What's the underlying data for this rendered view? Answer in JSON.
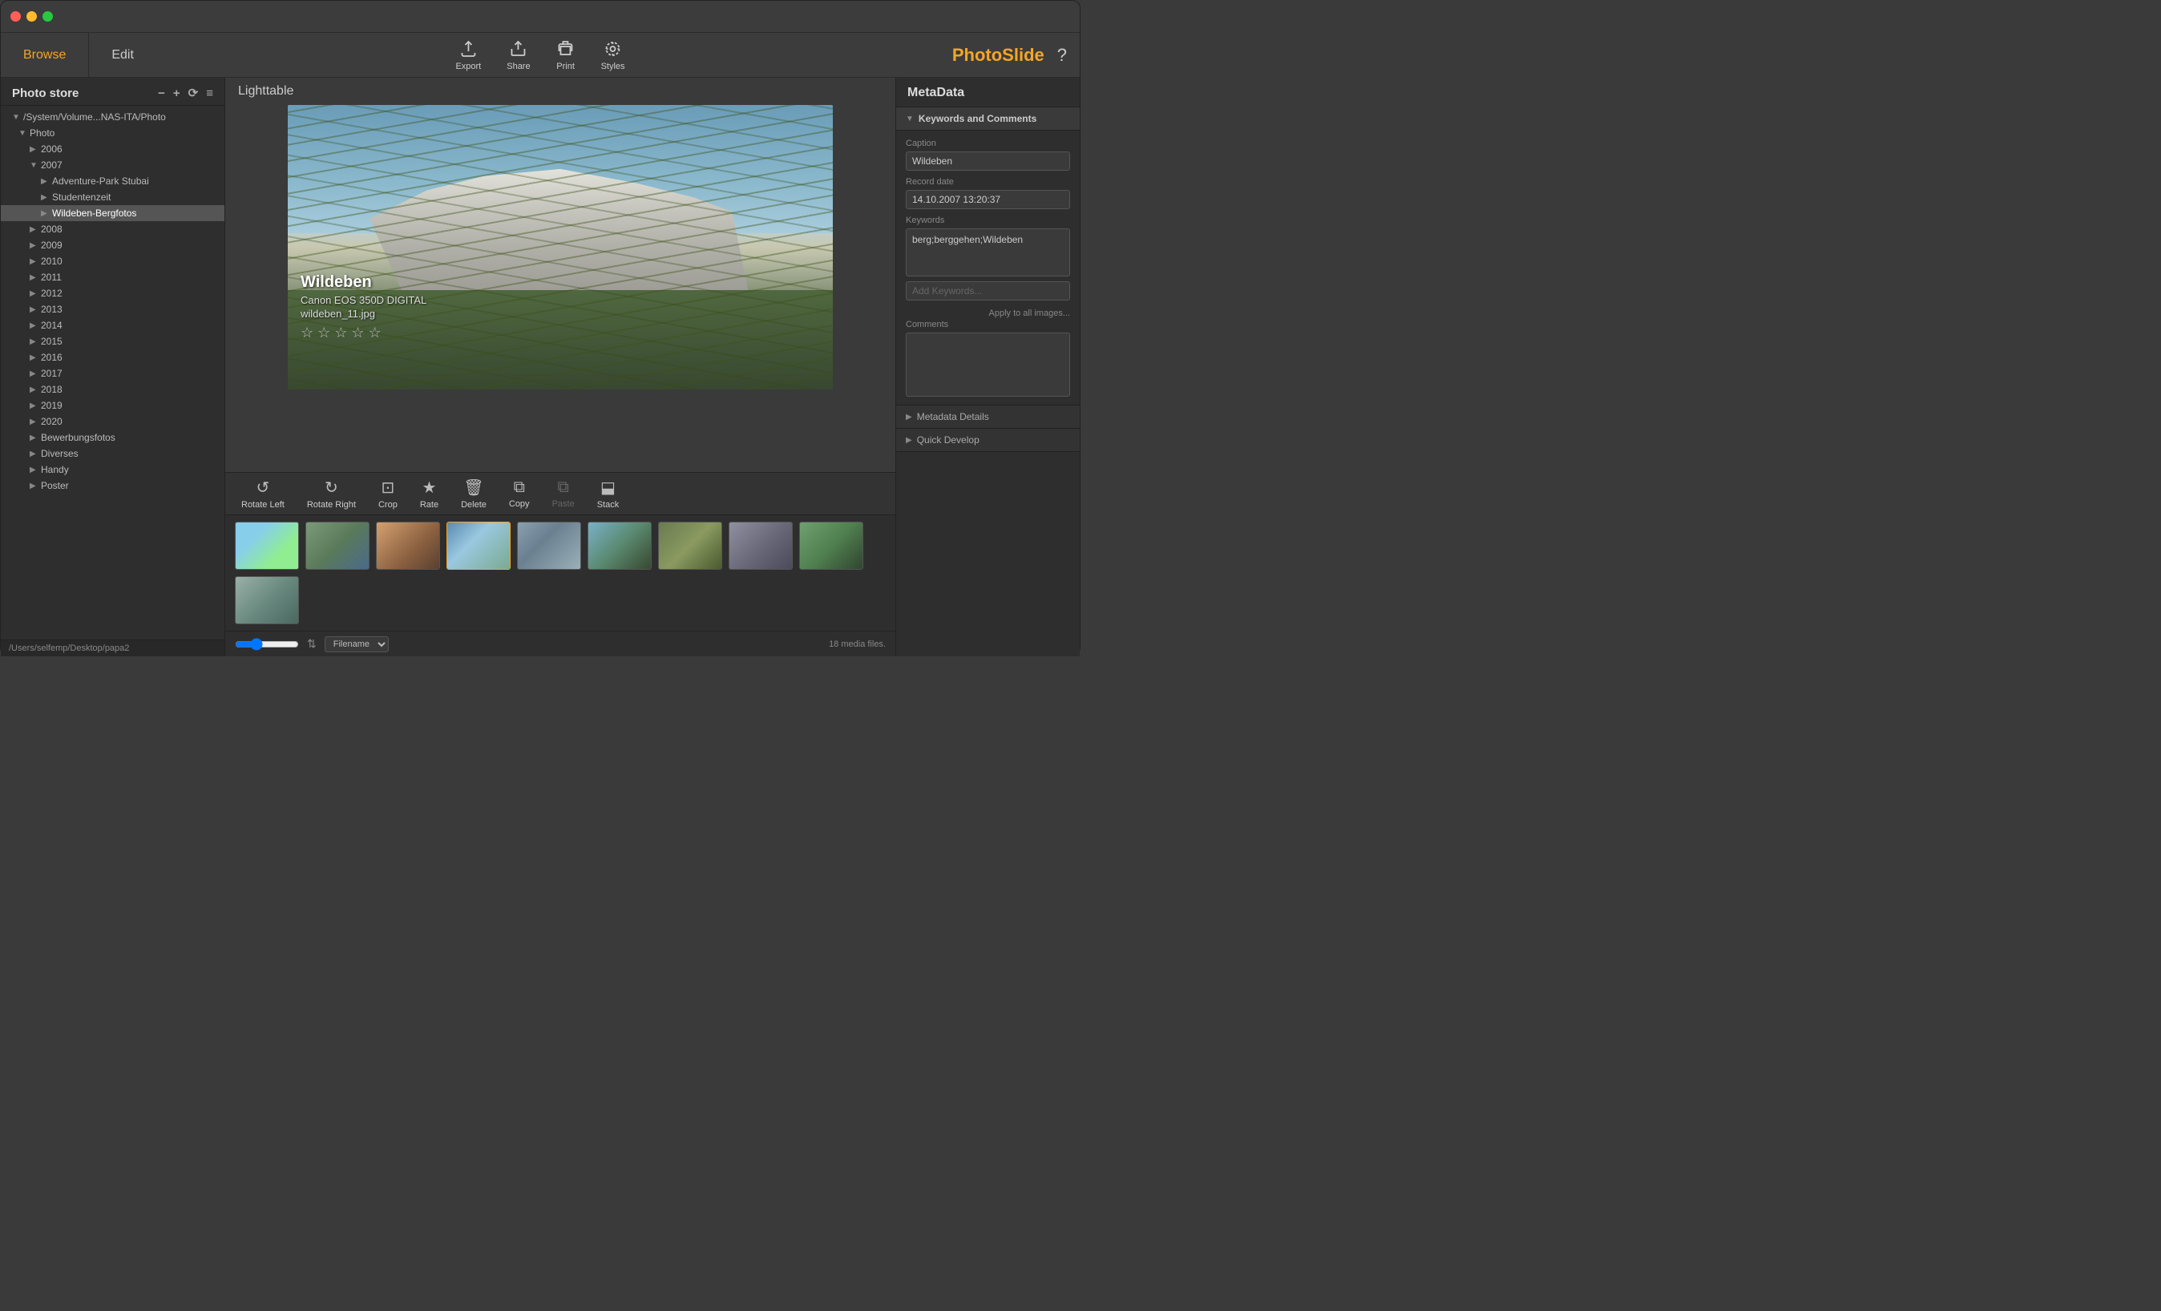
{
  "app": {
    "title": "PhotoSlide",
    "help_label": "Help"
  },
  "window_controls": {
    "close": "close",
    "minimize": "minimize",
    "maximize": "maximize"
  },
  "nav": {
    "browse_tab": "Browse",
    "edit_tab": "Edit",
    "export_label": "Export",
    "share_label": "Share",
    "print_label": "Print",
    "styles_label": "Styles"
  },
  "sidebar": {
    "title": "Photo store",
    "path1": "/System/Volume...NAS-ITA/Photo",
    "path2": "/Users/selfemp/Desktop/papa2",
    "root_label": "Photo",
    "items": [
      {
        "label": "/System/Volume...NAS-ITA/Photo",
        "indent": 0,
        "arrow": "▼",
        "selected": false
      },
      {
        "label": "Photo",
        "indent": 1,
        "arrow": "▼",
        "selected": false
      },
      {
        "label": "2006",
        "indent": 2,
        "arrow": "▶",
        "selected": false
      },
      {
        "label": "2007",
        "indent": 2,
        "arrow": "▼",
        "selected": false
      },
      {
        "label": "Adventure-Park Stubai",
        "indent": 3,
        "arrow": "▶",
        "selected": false
      },
      {
        "label": "Studentenzeit",
        "indent": 3,
        "arrow": "▶",
        "selected": false
      },
      {
        "label": "Wildeben-Bergfotos",
        "indent": 3,
        "arrow": "▶",
        "selected": true
      },
      {
        "label": "2008",
        "indent": 2,
        "arrow": "▶",
        "selected": false
      },
      {
        "label": "2009",
        "indent": 2,
        "arrow": "▶",
        "selected": false
      },
      {
        "label": "2010",
        "indent": 2,
        "arrow": "▶",
        "selected": false
      },
      {
        "label": "2011",
        "indent": 2,
        "arrow": "▶",
        "selected": false
      },
      {
        "label": "2012",
        "indent": 2,
        "arrow": "▶",
        "selected": false
      },
      {
        "label": "2013",
        "indent": 2,
        "arrow": "▶",
        "selected": false
      },
      {
        "label": "2014",
        "indent": 2,
        "arrow": "▶",
        "selected": false
      },
      {
        "label": "2015",
        "indent": 2,
        "arrow": "▶",
        "selected": false
      },
      {
        "label": "2016",
        "indent": 2,
        "arrow": "▶",
        "selected": false
      },
      {
        "label": "2017",
        "indent": 2,
        "arrow": "▶",
        "selected": false
      },
      {
        "label": "2018",
        "indent": 2,
        "arrow": "▶",
        "selected": false
      },
      {
        "label": "2019",
        "indent": 2,
        "arrow": "▶",
        "selected": false
      },
      {
        "label": "2020",
        "indent": 2,
        "arrow": "▶",
        "selected": false
      },
      {
        "label": "Bewerbungsfotos",
        "indent": 2,
        "arrow": "▶",
        "selected": false
      },
      {
        "label": "Diverses",
        "indent": 2,
        "arrow": "▶",
        "selected": false
      },
      {
        "label": "Handy",
        "indent": 2,
        "arrow": "▶",
        "selected": false
      },
      {
        "label": "Poster",
        "indent": 2,
        "arrow": "▶",
        "selected": false
      }
    ]
  },
  "lighttable": {
    "title": "Lighttable",
    "image_title": "Wildeben",
    "image_camera": "Canon EOS 350D DIGITAL",
    "image_filename": "wildeben_11.jpg",
    "stars": "★★★★★"
  },
  "toolbar": {
    "rotate_left": "Rotate Left",
    "rotate_right": "Rotate Right",
    "crop": "Crop",
    "rate": "Rate",
    "delete": "Delete",
    "copy": "Copy",
    "paste": "Paste",
    "stack": "Stack"
  },
  "filmstrip": {
    "thumbs": [
      {
        "id": 1,
        "class": "thumb-1",
        "selected": false
      },
      {
        "id": 2,
        "class": "thumb-2",
        "selected": false
      },
      {
        "id": 3,
        "class": "thumb-3",
        "selected": false
      },
      {
        "id": 4,
        "class": "thumb-4",
        "selected": true
      },
      {
        "id": 5,
        "class": "thumb-5",
        "selected": false
      },
      {
        "id": 6,
        "class": "thumb-6",
        "selected": false
      },
      {
        "id": 7,
        "class": "thumb-7",
        "selected": false
      },
      {
        "id": 8,
        "class": "thumb-8",
        "selected": false
      },
      {
        "id": 9,
        "class": "thumb-9",
        "selected": false
      },
      {
        "id": 10,
        "class": "thumb-10",
        "selected": false
      }
    ]
  },
  "bottom_bar": {
    "sort_label": "Filename",
    "media_count": "18 media files."
  },
  "metadata": {
    "title": "MetaData",
    "sections": {
      "keywords_comments": {
        "label": "Keywords and Comments",
        "expanded": true,
        "caption_label": "Caption",
        "caption_value": "Wildeben",
        "record_date_label": "Record date",
        "record_date_value": "14.10.2007 13:20:37",
        "keywords_label": "Keywords",
        "keywords_value": "berg;berggehen;Wildeben",
        "add_keywords_placeholder": "Add Keywords...",
        "apply_btn": "Apply to all images...",
        "comments_label": "Comments",
        "comments_value": ""
      },
      "metadata_details": {
        "label": "Metadata Details",
        "expanded": false
      },
      "quick_develop": {
        "label": "Quick Develop",
        "expanded": false
      }
    }
  }
}
